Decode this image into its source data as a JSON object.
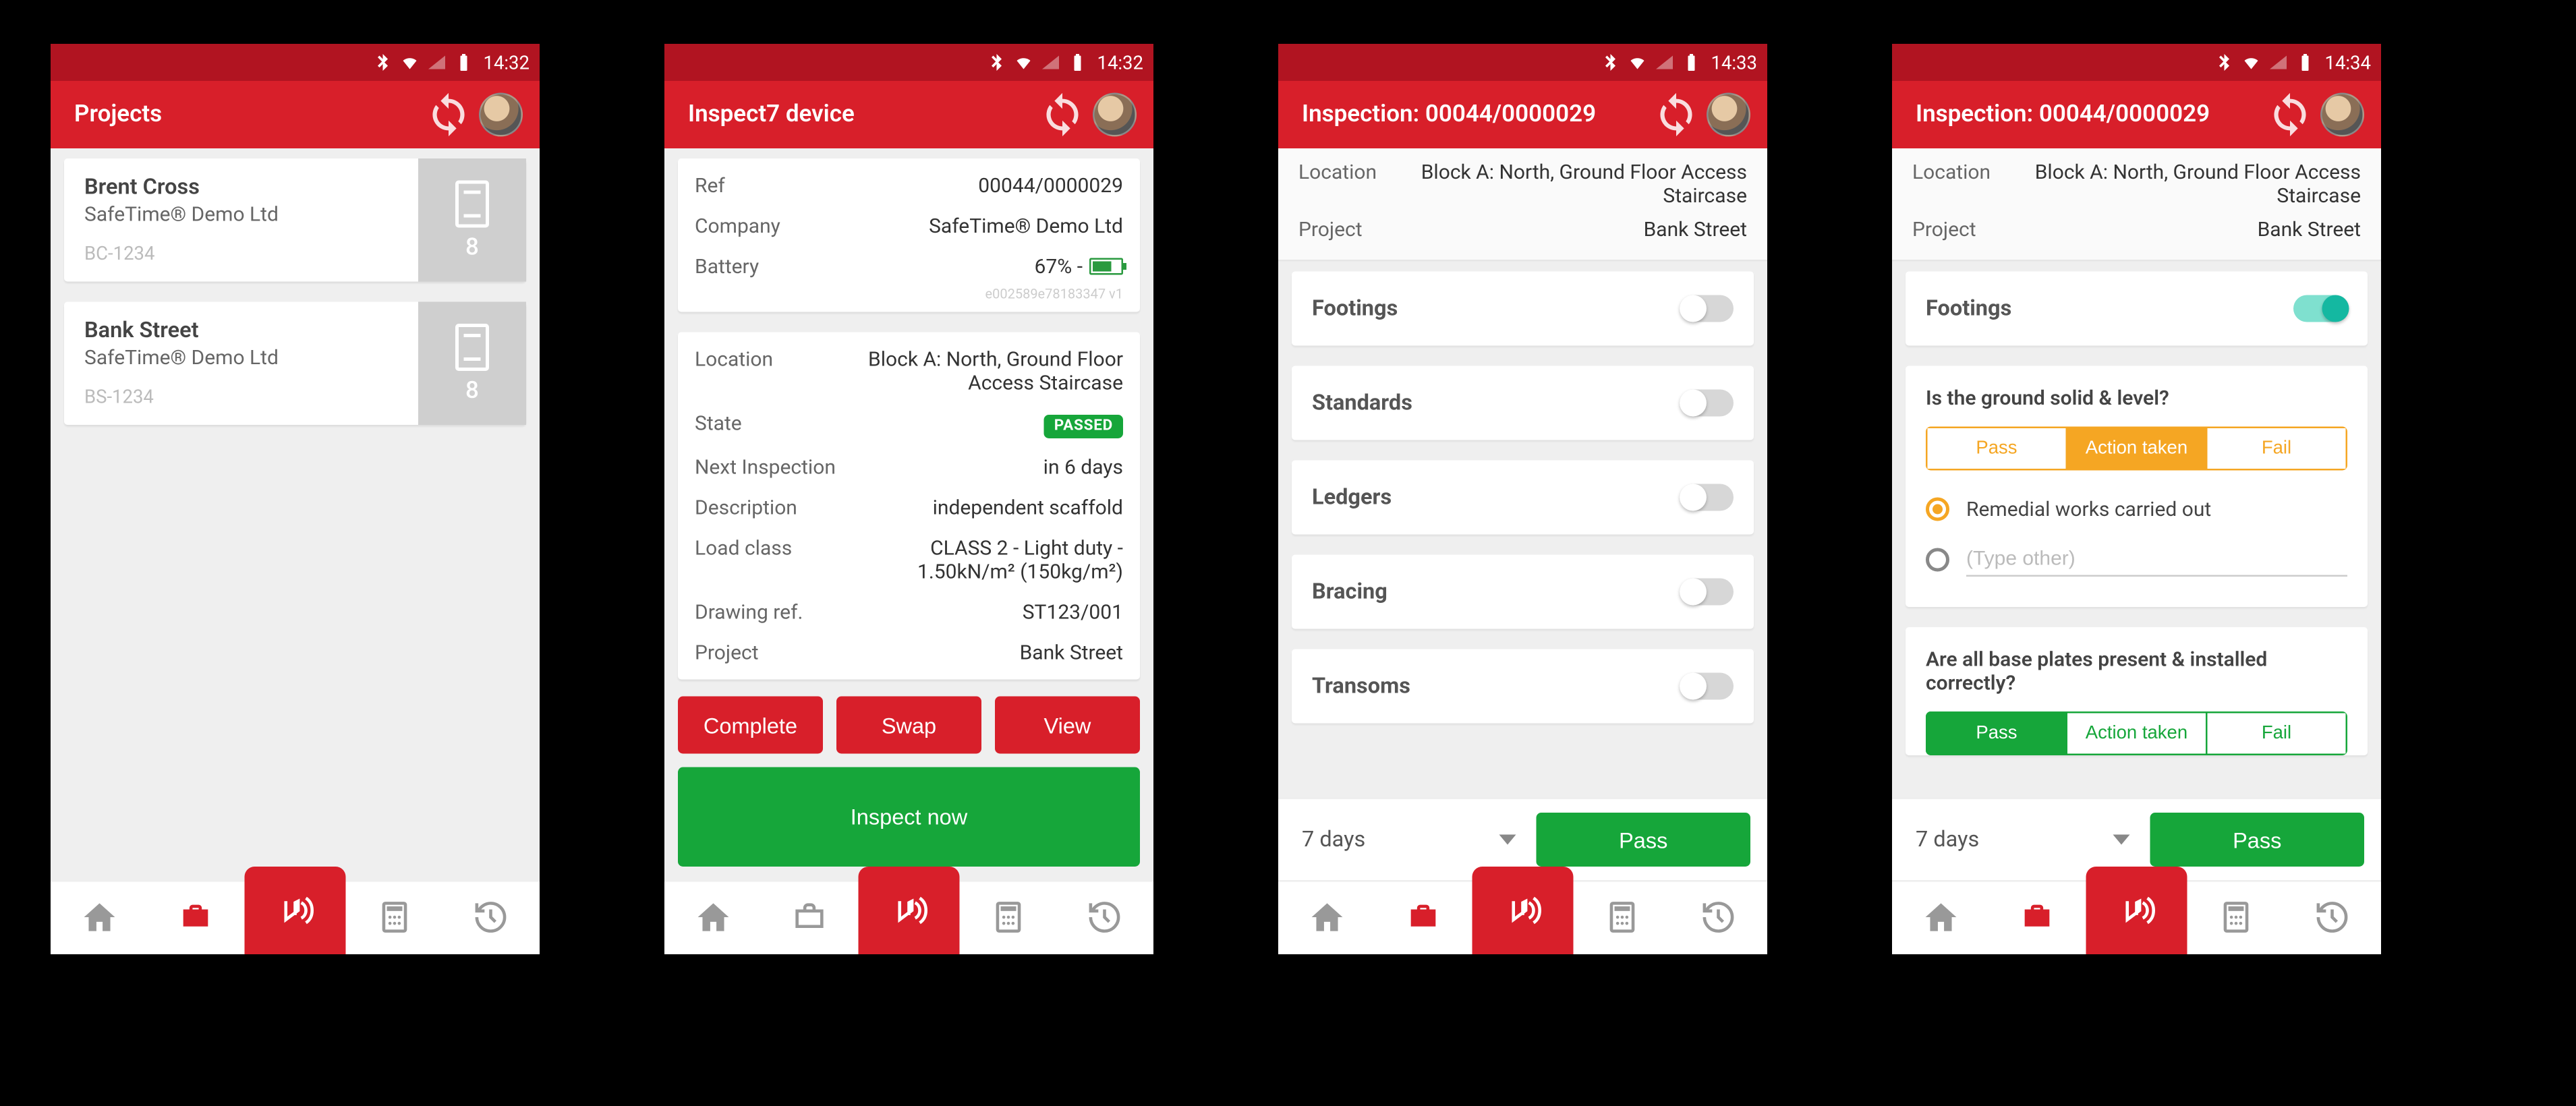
{
  "status": {
    "times": [
      "14:32",
      "14:32",
      "14:33",
      "14:34"
    ]
  },
  "screen1": {
    "title": "Projects",
    "projects": [
      {
        "name": "Brent Cross",
        "company": "SafeTime® Demo Ltd",
        "code": "BC-1234",
        "count": "8"
      },
      {
        "name": "Bank Street",
        "company": "SafeTime® Demo Ltd",
        "code": "BS-1234",
        "count": "8"
      }
    ]
  },
  "screen2": {
    "title": "Inspect7 device",
    "ref_label": "Ref",
    "ref": "00044/0000029",
    "company_label": "Company",
    "company": "SafeTime® Demo Ltd",
    "battery_label": "Battery",
    "battery": "67% -",
    "deviceid": "e002589e78183347 v1",
    "location_label": "Location",
    "location": "Block A: North, Ground Floor Access Staircase",
    "state_label": "State",
    "state_badge": "PASSED",
    "next_label": "Next Inspection",
    "next": "in 6 days",
    "desc_label": "Description",
    "desc": "independent scaffold",
    "load_label": "Load class",
    "load": "CLASS 2 - Light duty - 1.50kN/m² (150kg/m²)",
    "drawing_label": "Drawing ref.",
    "drawing": "ST123/001",
    "project_label": "Project",
    "project": "Bank Street",
    "btn_complete": "Complete",
    "btn_swap": "Swap",
    "btn_view": "View",
    "btn_inspect": "Inspect now"
  },
  "screen3": {
    "title": "Inspection: 00044/0000029",
    "location_label": "Location",
    "location": "Block A: North, Ground Floor Access Staircase",
    "project_label": "Project",
    "project": "Bank Street",
    "items": [
      "Footings",
      "Standards",
      "Ledgers",
      "Bracing",
      "Transoms"
    ],
    "dropdown": "7 days",
    "pass_btn": "Pass"
  },
  "screen4": {
    "title": "Inspection: 00044/0000029",
    "location_label": "Location",
    "location": "Block A: North, Ground Floor Access Staircase",
    "project_label": "Project",
    "project": "Bank Street",
    "section": "Footings",
    "q1": "Is the ground solid & level?",
    "seg_labels": {
      "pass": "Pass",
      "action": "Action taken",
      "fail": "Fail"
    },
    "r1": "Remedial works carried out",
    "r2_placeholder": "(Type other)",
    "q2": "Are all base plates present & installed correctly?",
    "dropdown": "7 days",
    "pass_btn": "Pass"
  }
}
